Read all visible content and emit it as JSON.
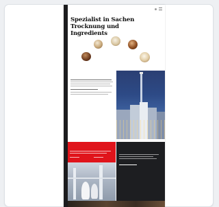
{
  "hero": {
    "title": "Spezialist in Sachen Trocknung und Ingredients",
    "subtitle": ""
  },
  "colors": {
    "accent_red": "#e0141b",
    "dark_panel": "#1d1e21",
    "page_bg": "#ffffff"
  },
  "icons": [
    "menu-icon",
    "search-icon"
  ],
  "sections": {
    "intro_heading": "",
    "red_heading": "",
    "dark_label": "",
    "dark_heading": "",
    "bottom_label": ""
  }
}
